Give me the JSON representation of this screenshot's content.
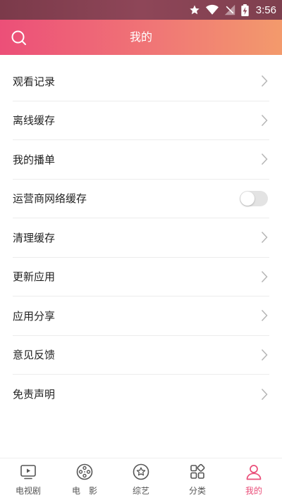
{
  "status_bar": {
    "time": "3:56"
  },
  "header": {
    "title": "我的",
    "search_icon": "search-icon"
  },
  "menu": {
    "items": [
      {
        "label": "观看记录",
        "control": "chevron"
      },
      {
        "label": "离线缓存",
        "control": "chevron"
      },
      {
        "label": "我的播单",
        "control": "chevron"
      },
      {
        "label": "运营商网络缓存",
        "control": "toggle",
        "toggle_on": false
      },
      {
        "label": "清理缓存",
        "control": "chevron"
      },
      {
        "label": "更新应用",
        "control": "chevron"
      },
      {
        "label": "应用分享",
        "control": "chevron"
      },
      {
        "label": "意见反馈",
        "control": "chevron"
      },
      {
        "label": "免责声明",
        "control": "chevron"
      }
    ]
  },
  "tabbar": {
    "active": "我的",
    "tabs": [
      {
        "label": "电视剧",
        "icon": "tv-icon"
      },
      {
        "label": "电　影",
        "icon": "film-reel-icon"
      },
      {
        "label": "综艺",
        "icon": "star-circle-icon"
      },
      {
        "label": "分类",
        "icon": "grid-icon"
      },
      {
        "label": "我的",
        "icon": "person-icon"
      }
    ]
  },
  "colors": {
    "header_gradient_start": "#ec4f78",
    "header_gradient_end": "#f39a6c",
    "active_tab": "#ea4d78"
  }
}
